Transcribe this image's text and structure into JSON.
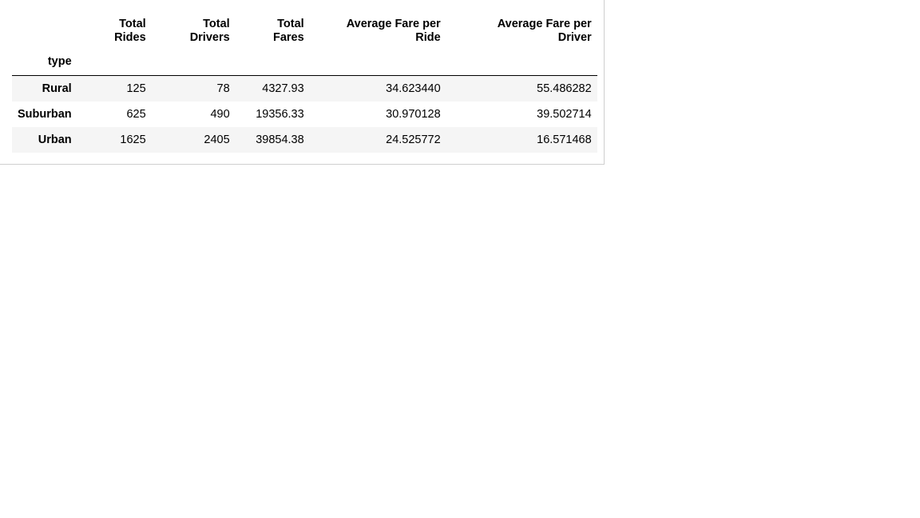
{
  "table": {
    "index_name": "type",
    "columns": [
      {
        "line1": "Total",
        "line2": "Rides"
      },
      {
        "line1": "Total",
        "line2": "Drivers"
      },
      {
        "line1": "Total",
        "line2": "Fares"
      },
      {
        "line1": "Average Fare per",
        "line2": "Ride"
      },
      {
        "line1": "Average Fare per",
        "line2": "Driver"
      }
    ],
    "rows": [
      {
        "index": "Rural",
        "values": [
          "125",
          "78",
          "4327.93",
          "34.623440",
          "55.486282"
        ]
      },
      {
        "index": "Suburban",
        "values": [
          "625",
          "490",
          "19356.33",
          "30.970128",
          "39.502714"
        ]
      },
      {
        "index": "Urban",
        "values": [
          "1625",
          "2405",
          "39854.38",
          "24.525772",
          "16.571468"
        ]
      }
    ]
  },
  "colors": {
    "stripe": "#f5f5f5",
    "frame_border": "#cfcfcf",
    "header_rule": "#000000"
  }
}
